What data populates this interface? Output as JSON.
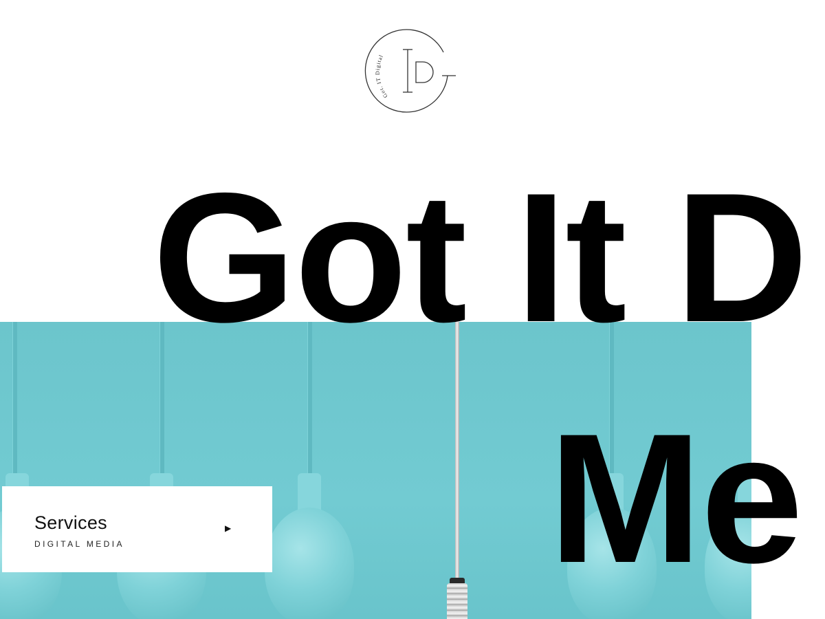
{
  "logo": {
    "monogram": "ID",
    "ring_text": "Got. IT Digital"
  },
  "hero": {
    "line1": "Got It D",
    "line2": "Me"
  },
  "services_card": {
    "title": "Services",
    "subtitle": "DIGITAL MEDIA",
    "arrow_icon": "play-arrow-icon"
  },
  "colors": {
    "background": "#ffffff",
    "hero_teal": "#6cc5cc",
    "text": "#000000"
  }
}
